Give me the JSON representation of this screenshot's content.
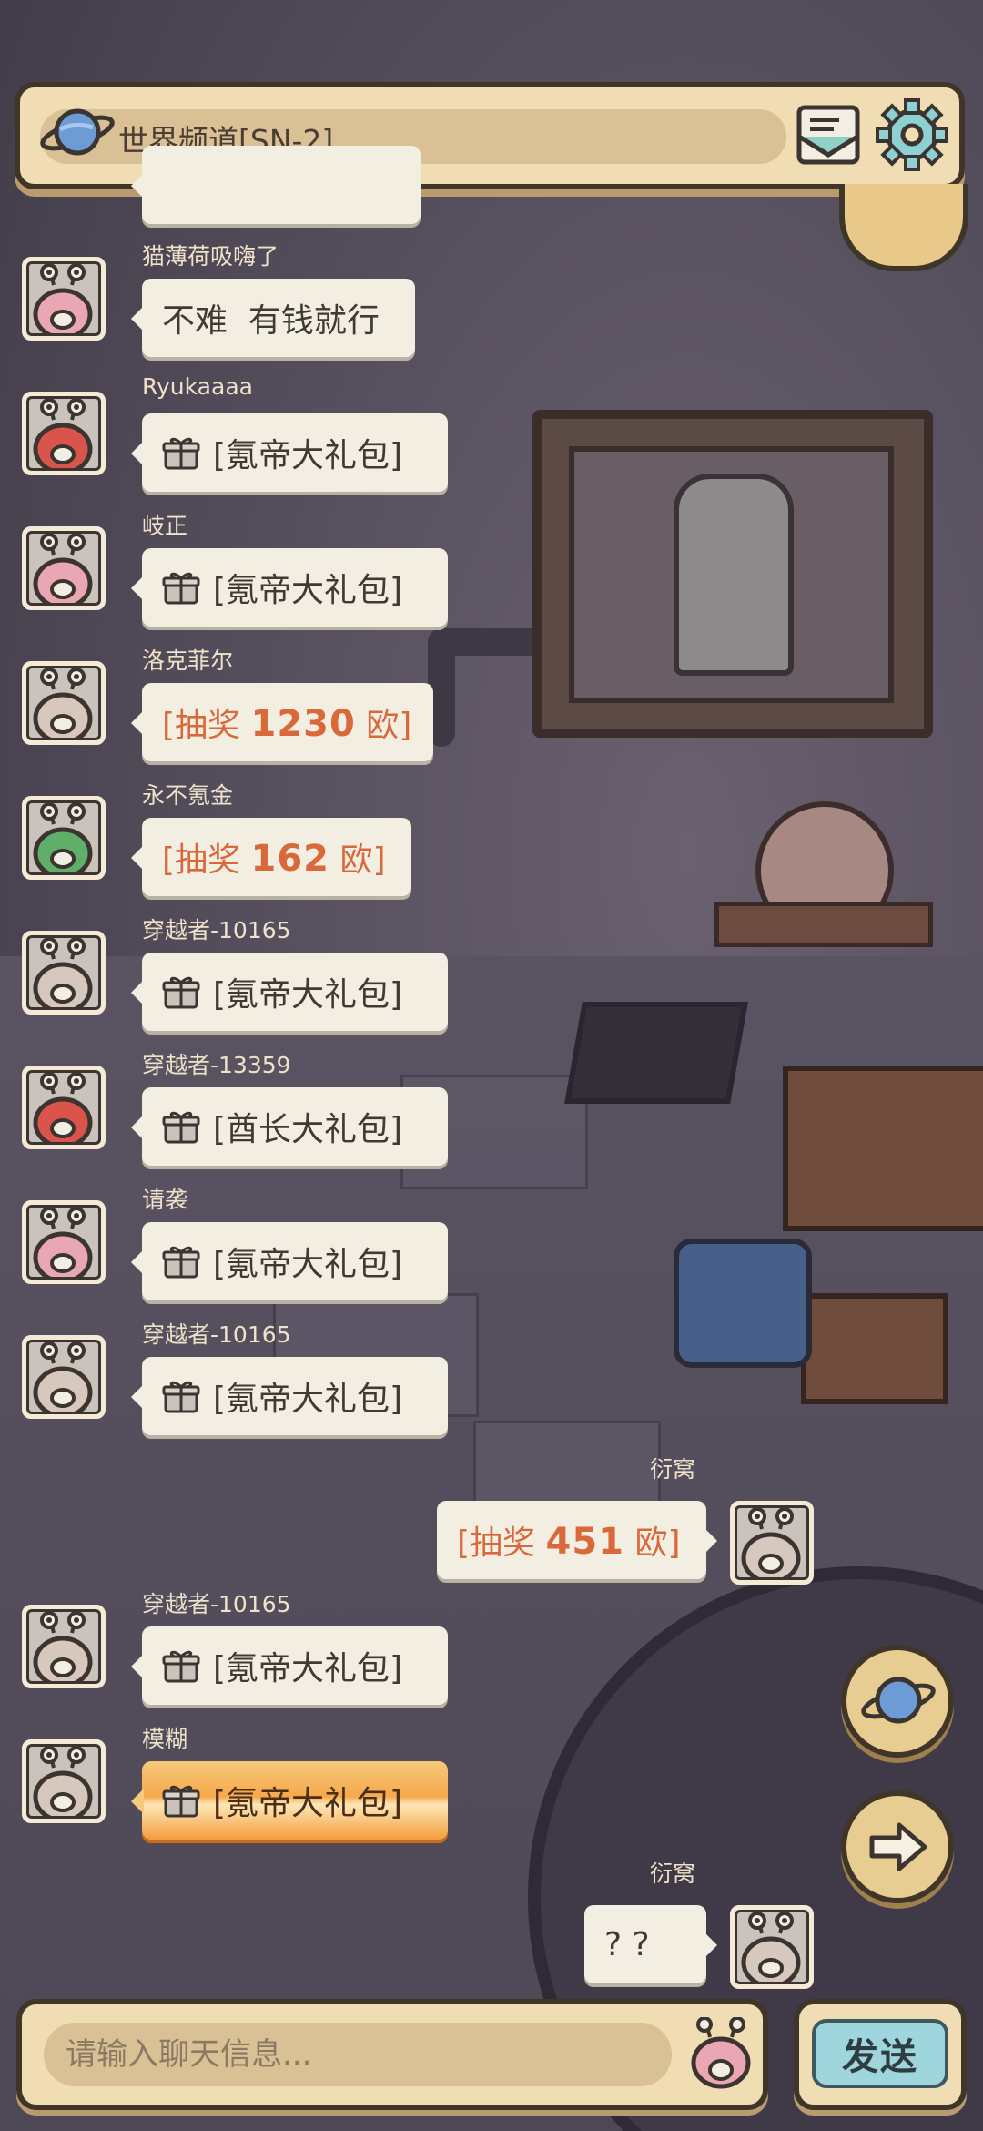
{
  "header": {
    "channel_title": "世界频道[SN-2]"
  },
  "colors": {
    "header_bg": "#f1ddb3",
    "bubble_bg": "#f3eee2",
    "lottery_text": "#d9683a",
    "golden_bubble": "#f5a94c",
    "send_button": "#9fd6de"
  },
  "messages": [
    {
      "sender": "猫薄荷吸嗨了",
      "side": "left",
      "type": "text",
      "text": "不难  有钱就行"
    },
    {
      "sender": "Ryukaaaa",
      "side": "left",
      "type": "gift",
      "text": "[氪帝大礼包]"
    },
    {
      "sender": "岐正",
      "side": "left",
      "type": "gift",
      "text": "[氪帝大礼包]"
    },
    {
      "sender": "洛克菲尔",
      "side": "left",
      "type": "lottery",
      "prefix": "[抽奖 ",
      "amount": "1230",
      "suffix": " 欧]"
    },
    {
      "sender": "永不氪金",
      "side": "left",
      "type": "lottery",
      "prefix": "[抽奖 ",
      "amount": "162",
      "suffix": " 欧]"
    },
    {
      "sender": "穿越者-10165",
      "side": "left",
      "type": "gift",
      "text": "[氪帝大礼包]"
    },
    {
      "sender": "穿越者-13359",
      "side": "left",
      "type": "gift",
      "text": "[酋长大礼包]"
    },
    {
      "sender": "请袭",
      "side": "left",
      "type": "gift",
      "text": "[氪帝大礼包]"
    },
    {
      "sender": "穿越者-10165",
      "side": "left",
      "type": "gift",
      "text": "[氪帝大礼包]"
    },
    {
      "sender": "衍窝",
      "side": "right",
      "type": "lottery",
      "prefix": "[抽奖 ",
      "amount": "451",
      "suffix": " 欧]"
    },
    {
      "sender": "穿越者-10165",
      "side": "left",
      "type": "gift",
      "text": "[氪帝大礼包]"
    },
    {
      "sender": "模糊",
      "side": "left",
      "type": "gift_golden",
      "text": "[氪帝大礼包]"
    },
    {
      "sender": "衍窝",
      "side": "right",
      "type": "text",
      "text": "? ?"
    }
  ],
  "input": {
    "placeholder": "请输入聊天信息...",
    "send_label": "发送"
  },
  "icons": {
    "channel": "planet-icon",
    "mail": "mail-icon",
    "settings": "gear-icon",
    "gift": "gift-icon",
    "side_1": "planet-icon",
    "side_2": "arrow-right-icon",
    "emoji": "snail-face-icon"
  }
}
